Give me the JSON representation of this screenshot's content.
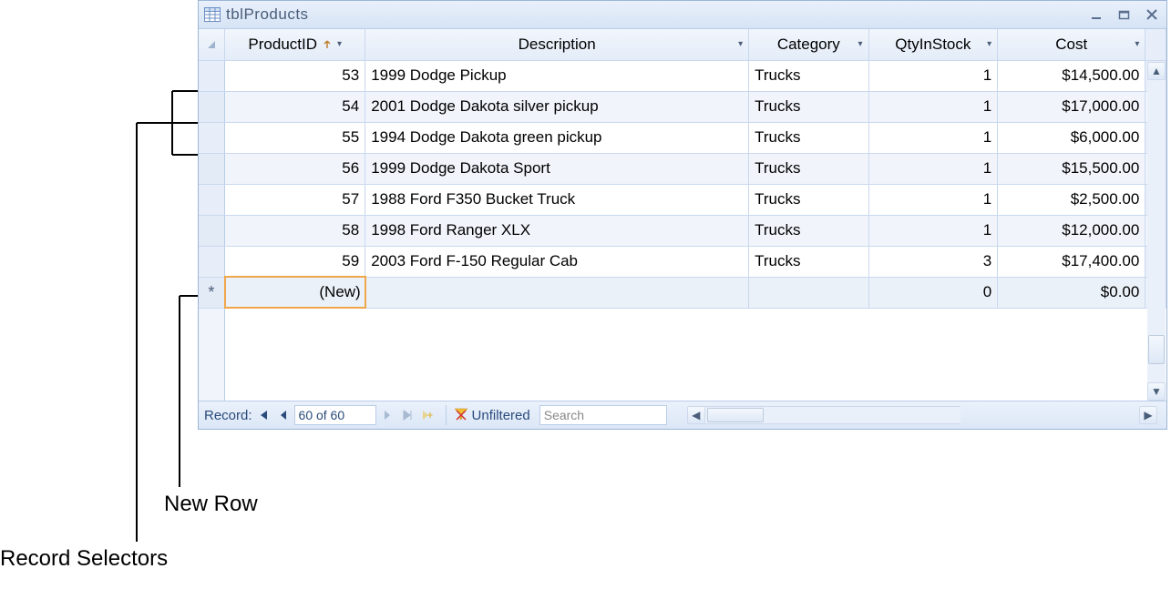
{
  "window": {
    "title": "tblProducts"
  },
  "columns": [
    {
      "label": "ProductID"
    },
    {
      "label": "Description"
    },
    {
      "label": "Category"
    },
    {
      "label": "QtyInStock"
    },
    {
      "label": "Cost"
    }
  ],
  "rows": [
    {
      "id": "53",
      "desc": "1999 Dodge Pickup",
      "cat": "Trucks",
      "qty": "1",
      "cost": "$14,500.00"
    },
    {
      "id": "54",
      "desc": "2001 Dodge Dakota silver pickup",
      "cat": "Trucks",
      "qty": "1",
      "cost": "$17,000.00"
    },
    {
      "id": "55",
      "desc": "1994 Dodge Dakota green pickup",
      "cat": "Trucks",
      "qty": "1",
      "cost": "$6,000.00"
    },
    {
      "id": "56",
      "desc": "1999 Dodge Dakota Sport",
      "cat": "Trucks",
      "qty": "1",
      "cost": "$15,500.00"
    },
    {
      "id": "57",
      "desc": "1988 Ford F350 Bucket Truck",
      "cat": "Trucks",
      "qty": "1",
      "cost": "$2,500.00"
    },
    {
      "id": "58",
      "desc": "1998 Ford Ranger XLX",
      "cat": "Trucks",
      "qty": "1",
      "cost": "$12,000.00"
    },
    {
      "id": "59",
      "desc": "2003 Ford F-150 Regular Cab",
      "cat": "Trucks",
      "qty": "3",
      "cost": "$17,400.00"
    }
  ],
  "newrow": {
    "id_label": "(New)",
    "qty": "0",
    "cost": "$0.00"
  },
  "nav": {
    "record_label": "Record:",
    "record_value": "60 of 60",
    "filter_label": "Unfiltered",
    "search_placeholder": "Search"
  },
  "callouts": {
    "new_row": "New Row",
    "record_selectors": "Record Selectors"
  }
}
